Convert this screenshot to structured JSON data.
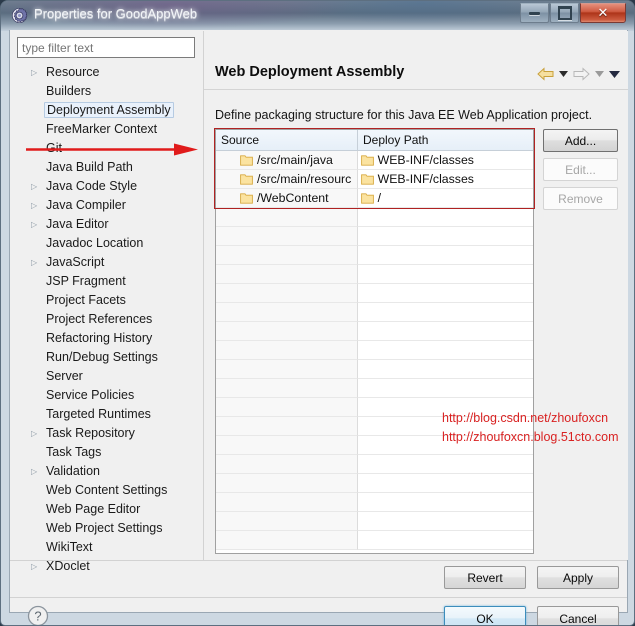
{
  "window": {
    "title": "Properties for GoodAppWeb",
    "icon": "gear-icon",
    "minimize_label": "Minimize",
    "maximize_label": "Maximize",
    "close_label": "✕"
  },
  "filter": {
    "placeholder": "type filter text",
    "value": ""
  },
  "tree": {
    "selected": "Deployment Assembly",
    "items": [
      {
        "label": "Resource",
        "expandable": true
      },
      {
        "label": "Builders",
        "expandable": false
      },
      {
        "label": "Deployment Assembly",
        "expandable": false
      },
      {
        "label": "FreeMarker Context",
        "expandable": false
      },
      {
        "label": "Git",
        "expandable": false
      },
      {
        "label": "Java Build Path",
        "expandable": false
      },
      {
        "label": "Java Code Style",
        "expandable": true
      },
      {
        "label": "Java Compiler",
        "expandable": true
      },
      {
        "label": "Java Editor",
        "expandable": true
      },
      {
        "label": "Javadoc Location",
        "expandable": false
      },
      {
        "label": "JavaScript",
        "expandable": true
      },
      {
        "label": "JSP Fragment",
        "expandable": false
      },
      {
        "label": "Project Facets",
        "expandable": false
      },
      {
        "label": "Project References",
        "expandable": false
      },
      {
        "label": "Refactoring History",
        "expandable": false
      },
      {
        "label": "Run/Debug Settings",
        "expandable": false
      },
      {
        "label": "Server",
        "expandable": false
      },
      {
        "label": "Service Policies",
        "expandable": false
      },
      {
        "label": "Targeted Runtimes",
        "expandable": false
      },
      {
        "label": "Task Repository",
        "expandable": true
      },
      {
        "label": "Task Tags",
        "expandable": false
      },
      {
        "label": "Validation",
        "expandable": true
      },
      {
        "label": "Web Content Settings",
        "expandable": false
      },
      {
        "label": "Web Page Editor",
        "expandable": false
      },
      {
        "label": "Web Project Settings",
        "expandable": false
      },
      {
        "label": "WikiText",
        "expandable": false
      },
      {
        "label": "XDoclet",
        "expandable": true
      }
    ]
  },
  "content": {
    "title": "Web Deployment Assembly",
    "description": "Define packaging structure for this Java EE Web Application project.",
    "nav": {
      "back_icon": "back-arrow-icon",
      "back_menu_icon": "chevron-down-icon",
      "forward_icon": "forward-arrow-icon",
      "forward_menu_icon": "chevron-down-icon",
      "menu_icon": "chevron-down-icon"
    }
  },
  "table": {
    "columns": [
      "Source",
      "Deploy Path"
    ],
    "sort_indicator": "▲",
    "rows": [
      {
        "source": "/src/main/java",
        "deploy": "WEB-INF/classes"
      },
      {
        "source": "/src/main/resourc",
        "deploy": "WEB-INF/classes"
      },
      {
        "source": "/WebContent",
        "deploy": "/"
      }
    ],
    "empty_row_count": 18
  },
  "side_buttons": [
    {
      "label": "Add...",
      "enabled": true
    },
    {
      "label": "Edit...",
      "enabled": false
    },
    {
      "label": "Remove",
      "enabled": false
    }
  ],
  "footer": {
    "revert_label": "Revert",
    "apply_label": "Apply",
    "ok_label": "OK",
    "cancel_label": "Cancel",
    "help_icon": "help-question-icon"
  },
  "annotations": {
    "watermark_line1": "http://blog.csdn.net/zhoufoxcn",
    "watermark_line2": "http://zhoufoxcn.blog.51cto.com",
    "watermark_color": "#d92222",
    "highlight_color": "#b02222",
    "arrow_color": "#e01b1b"
  }
}
